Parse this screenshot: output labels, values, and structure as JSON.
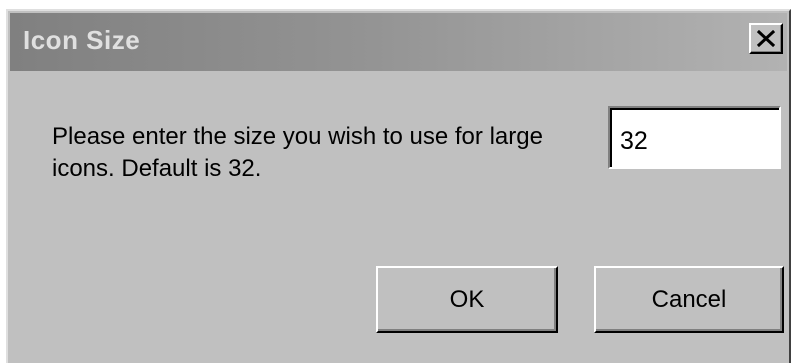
{
  "dialog": {
    "title": "Icon Size",
    "prompt": "Please enter the size you wish to use for large icons. Default is 32.",
    "input_value": "32",
    "ok_label": "OK",
    "cancel_label": "Cancel",
    "close_icon": "close-x-icon"
  },
  "colors": {
    "face": "#c0c0c0",
    "titlebar_start": "#808080",
    "titlebar_end": "#b2b2b2",
    "title_text": "#e0e0e0"
  }
}
